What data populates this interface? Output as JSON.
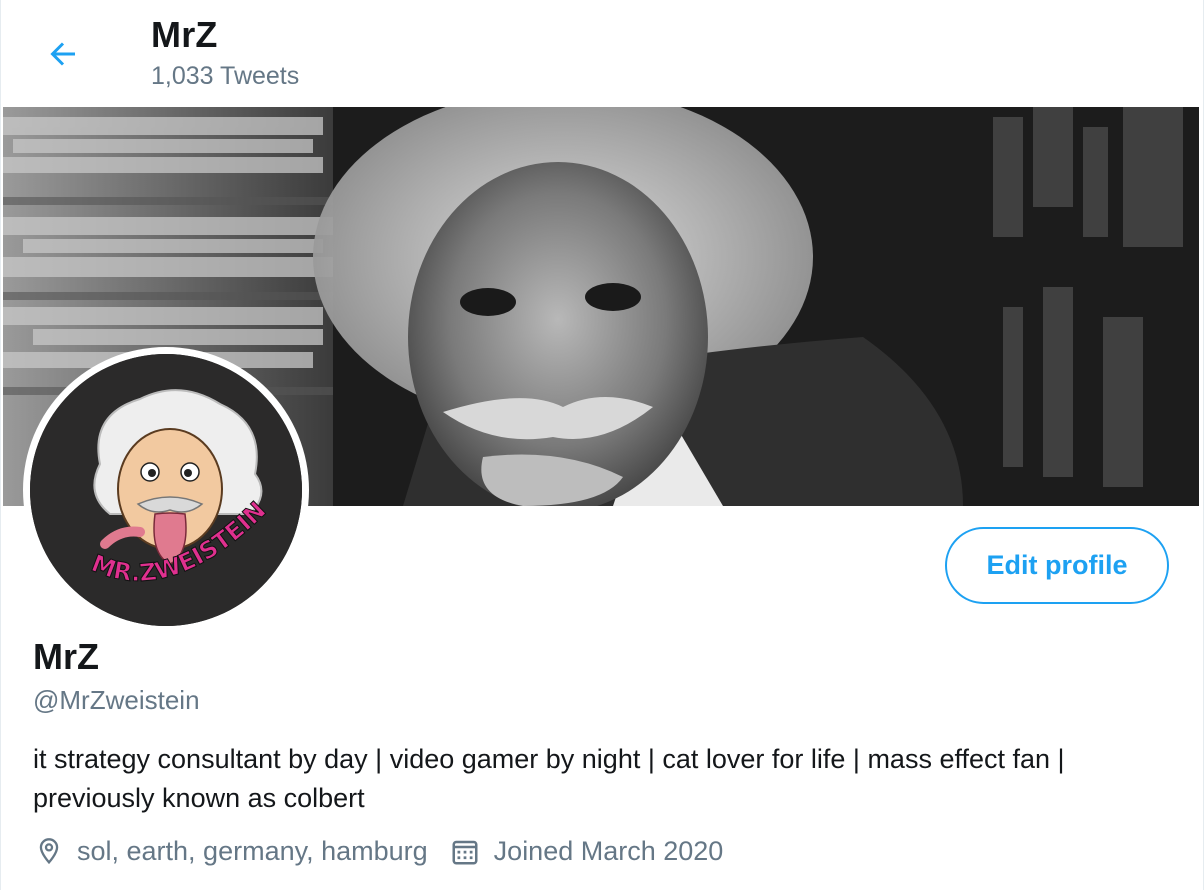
{
  "header": {
    "title": "MrZ",
    "tweet_count": "1,033 Tweets",
    "back_icon": "arrow-left-icon"
  },
  "avatar": {
    "logo_text": "MR.ZWEISTEIN"
  },
  "profile": {
    "edit_button": "Edit profile",
    "display_name": "MrZ",
    "handle": "@MrZweistein",
    "bio": "it strategy consultant by day | video gamer by night | cat lover for life | mass effect fan | previously known as colbert",
    "location": "sol, earth, germany, hamburg",
    "joined": "Joined March 2020"
  },
  "colors": {
    "accent": "#1da1f2",
    "secondary_text": "#657786",
    "primary_text": "#14171a",
    "logo_pink": "#e0308f"
  }
}
